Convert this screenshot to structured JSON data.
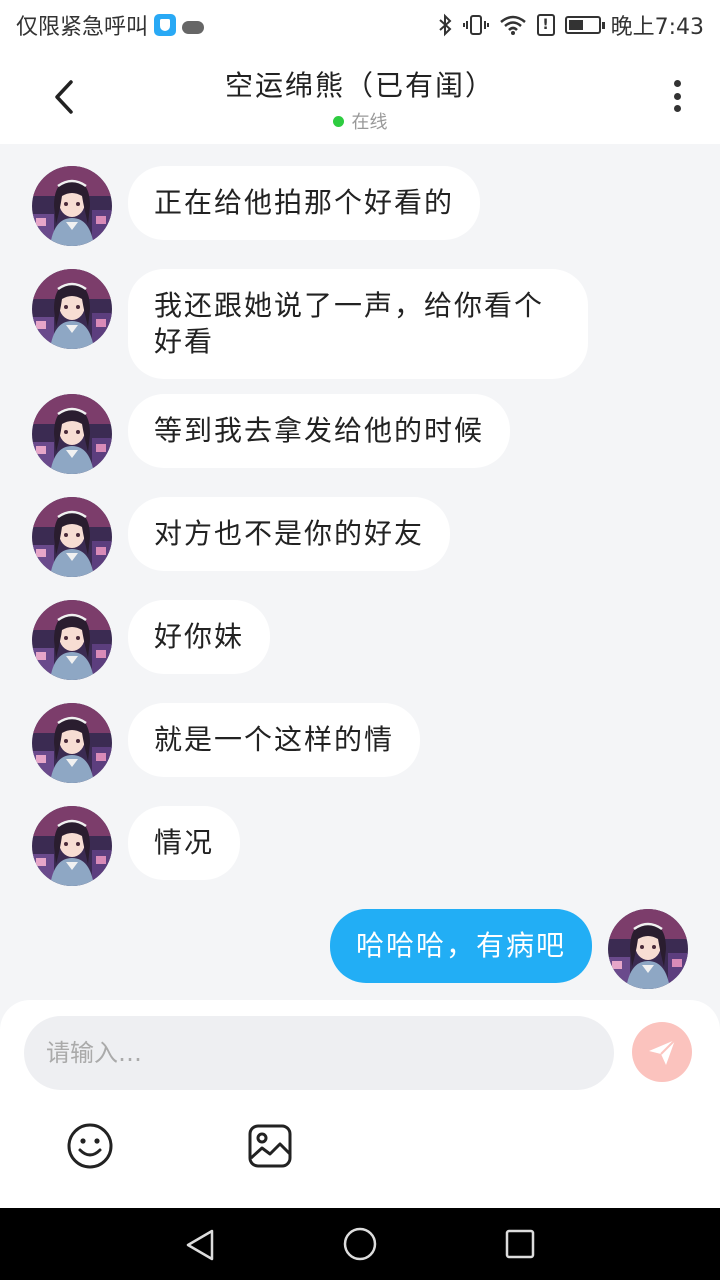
{
  "status_bar": {
    "left_text": "仅限紧急呼叫",
    "time": "晚上7:43"
  },
  "header": {
    "title": "空运绵熊（已有闺）",
    "status": "在线"
  },
  "messages": [
    {
      "from": "other",
      "text": "正在给他拍那个好看的"
    },
    {
      "from": "other",
      "text": "我还跟她说了一声，给你看个好看"
    },
    {
      "from": "other",
      "text": "等到我去拿发给他的时候"
    },
    {
      "from": "other",
      "text": "对方也不是你的好友"
    },
    {
      "from": "other",
      "text": "好你妹"
    },
    {
      "from": "other",
      "text": "就是一个这样的情"
    },
    {
      "from": "other",
      "text": "情况"
    },
    {
      "from": "me",
      "text": "哈哈哈，有病吧"
    }
  ],
  "input": {
    "placeholder": "请输入…",
    "value": ""
  },
  "colors": {
    "accent": "#22aef5",
    "online": "#2ecc40",
    "send": "#fbc3be"
  },
  "icons": [
    "back-icon",
    "more-icon",
    "send-icon",
    "emoji-icon",
    "image-icon",
    "nav-back-icon",
    "nav-home-icon",
    "nav-recent-icon"
  ]
}
